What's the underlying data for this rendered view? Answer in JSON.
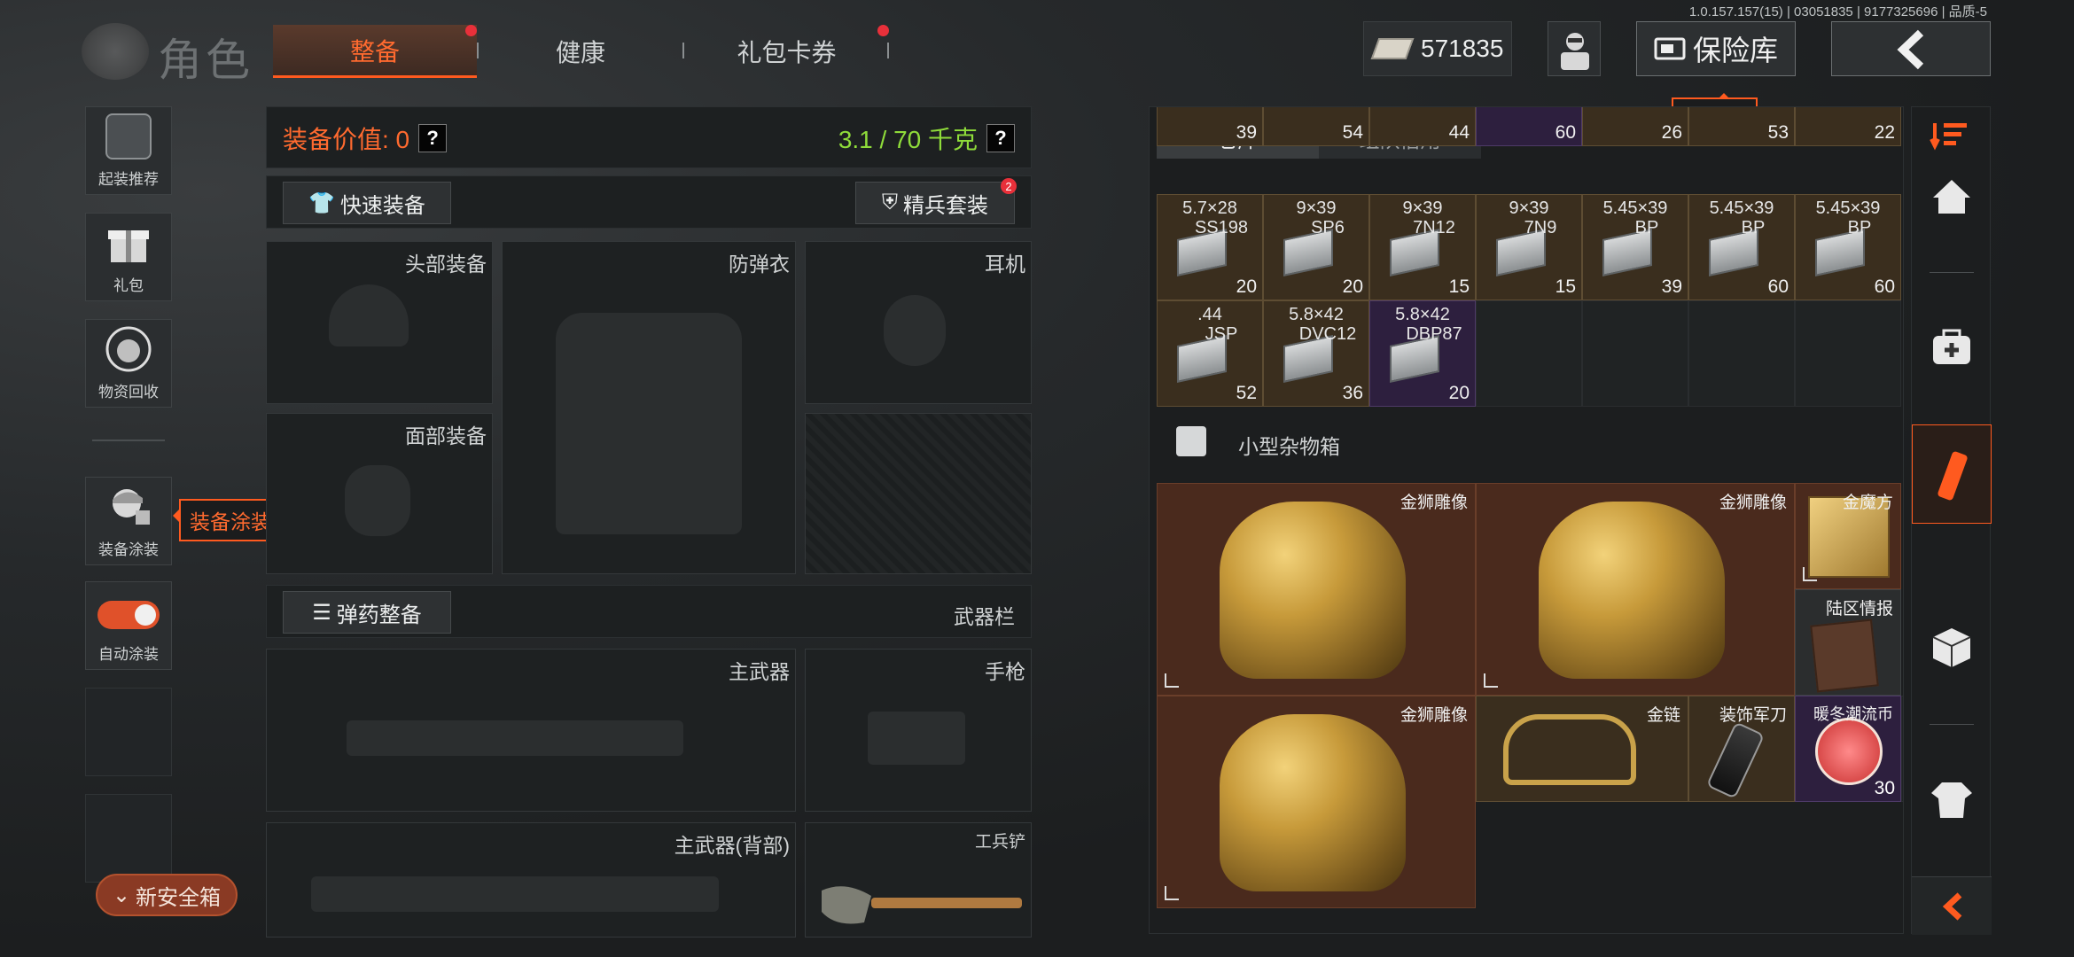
{
  "version": "1.0.157.157(15) | 03051835 | 9177325696 | 品质-5",
  "header": {
    "title": "角色",
    "tabs": [
      "整备",
      "健康",
      "礼包卡券"
    ],
    "money": "571835",
    "vault_button": "保险库",
    "vault_tooltip": "保险库"
  },
  "left_rail": {
    "items": [
      "起装推荐",
      "礼包",
      "物资回收",
      "装备涂装",
      "自动涂装"
    ],
    "skin_tooltip": "装备涂装",
    "safe_box_button": "新安全箱"
  },
  "loadout": {
    "value_label": "装备价值: 0",
    "weight_label": "3.1 / 70 千克",
    "help": "?",
    "quick_equip": "快速装备",
    "elite_set": "精兵套装",
    "elite_badge": "2",
    "slots": {
      "head": "头部装备",
      "armor": "防弹衣",
      "headset": "耳机",
      "face": "面部装备",
      "primary": "主武器",
      "pistol": "手枪",
      "primary_back": "主武器(背部)",
      "melee": "工兵铲"
    },
    "ammo_button": "弹药整备",
    "weapon_bar": "武器栏"
  },
  "storage": {
    "tabs": [
      "仓库",
      "组队借用"
    ],
    "top_partial_quantities": [
      "39",
      "54",
      "44",
      "60",
      "26",
      "53",
      "22"
    ],
    "ammo_row1": [
      {
        "caliber": "5.7×28",
        "type": "SS198",
        "qty": "20",
        "rarity": "gold"
      },
      {
        "caliber": "9×39",
        "type": "SP6",
        "qty": "20",
        "rarity": "gold"
      },
      {
        "caliber": "9×39",
        "type": "7N12",
        "qty": "15",
        "rarity": "gold"
      },
      {
        "caliber": "9×39",
        "type": "7N9",
        "qty": "15",
        "rarity": "gold"
      },
      {
        "caliber": "5.45×39",
        "type": "BP",
        "qty": "39",
        "rarity": "gold"
      },
      {
        "caliber": "5.45×39",
        "type": "BP",
        "qty": "60",
        "rarity": "gold"
      },
      {
        "caliber": "5.45×39",
        "type": "BP",
        "qty": "60",
        "rarity": "gold"
      }
    ],
    "ammo_row2": [
      {
        "caliber": ".44",
        "type": "JSP",
        "qty": "52",
        "rarity": "gold"
      },
      {
        "caliber": "5.8×42",
        "type": "DVC12",
        "qty": "36",
        "rarity": "gold"
      },
      {
        "caliber": "5.8×42",
        "type": "DBP87",
        "qty": "20",
        "rarity": "purple"
      }
    ],
    "misc_box_label": "小型杂物箱",
    "items": {
      "lion1": "金狮雕像",
      "lion2": "金狮雕像",
      "lion3": "金狮雕像",
      "gold_cube": "金魔方",
      "intel": "陆区情报",
      "gold_chain": "金链",
      "knife": "装饰军刀",
      "coin": "暖冬潮流币",
      "coin_qty": "30"
    }
  },
  "colors": {
    "accent": "#ff5a1f",
    "weight": "#8fdc3a",
    "gold_cell": "#3a2e1e",
    "purple_cell": "#2d1f3e",
    "brown_cell": "#4a2a1d"
  }
}
